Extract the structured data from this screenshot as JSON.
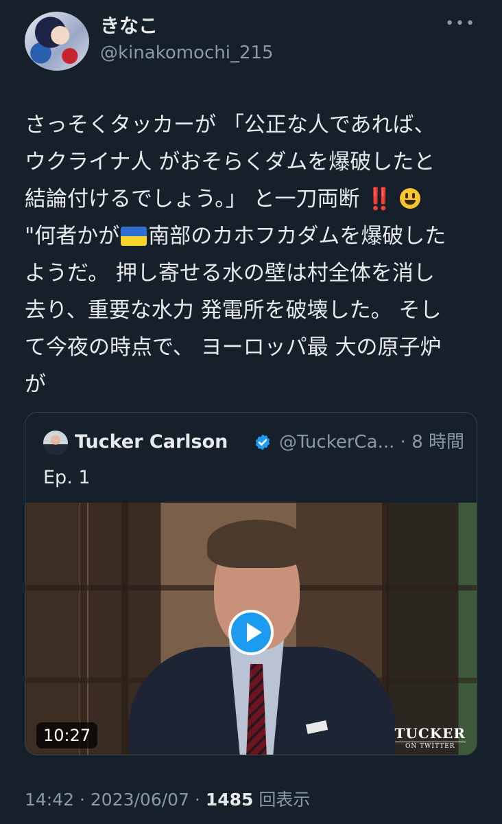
{
  "author": {
    "display_name": "きなこ",
    "handle": "@kinakomochi_215",
    "more_icon": "more-dots-icon"
  },
  "tweet": {
    "lines": [
      "さっそくタッカーが 「公正な人であれば、",
      "ウクライナ人 がおそらくダムを爆破したと",
      "結論付けるでしょう。」 と一刀両断",
      "\"何者かが",
      "南部のカホフカダムを爆破した",
      "ようだ。 押し寄せる水の壁は村全体を消し",
      "去り、重要な水力 発電所を破壊した。 そし",
      "て今夜の時点で、 ヨーロッパ最 大の原子炉",
      "が"
    ],
    "exclaim": "‼️",
    "emoji_smile": "smiley-face-emoji",
    "flag": "ukraine-flag-emoji"
  },
  "quote": {
    "name": "Tucker Carlson",
    "verified_icon": "verified-badge-icon",
    "meta": "@TuckerCa... · 8 時間",
    "text": "Ep. 1",
    "video": {
      "duration": "10:27",
      "watermark_main": "TUCKER",
      "watermark_sub": "ON TWITTER",
      "play_icon": "play-icon"
    }
  },
  "footer": {
    "time": "14:42",
    "sep": " · ",
    "date": "2023/06/07",
    "sep2": " · ",
    "views": "1485",
    "views_label": " 回表示"
  },
  "colors": {
    "background": "#15202b",
    "accent": "#1d9bf0",
    "secondary_text": "#8b98a5"
  }
}
